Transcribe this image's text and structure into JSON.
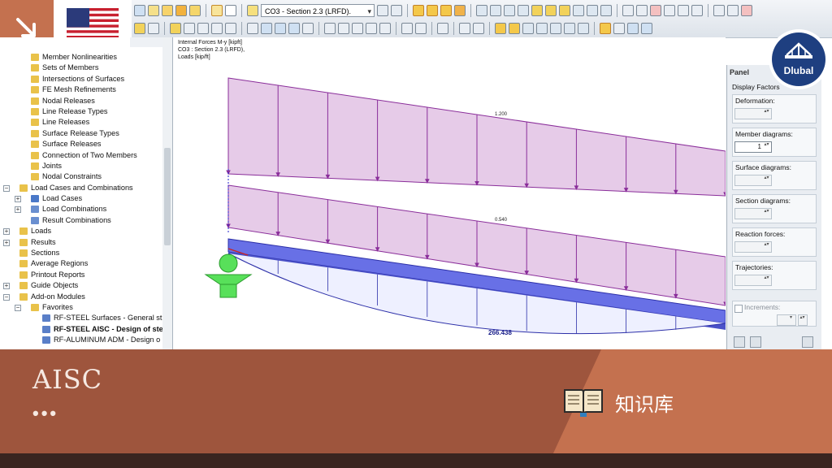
{
  "toolbar": {
    "loadcase_combo": "CO3 - Section 2.3 (LRFD).",
    "icons": [
      "undo-icon",
      "pen-icon",
      "magnifier-icon",
      "results-icon",
      "grid-icon",
      "table-icon",
      "arrow-left-icon",
      "arrow-right-icon",
      "display-icon",
      "view-icon",
      "select-icon",
      "render-icon",
      "settings-icon"
    ]
  },
  "navigator": {
    "pin_glyph": "ᐅ",
    "close_glyph": "×",
    "items": [
      {
        "label": "Member Nonlinearities",
        "level": 2,
        "icon": "folder"
      },
      {
        "label": "Sets of Members",
        "level": 2,
        "icon": "folder"
      },
      {
        "label": "Intersections of Surfaces",
        "level": 2,
        "icon": "folder"
      },
      {
        "label": "FE Mesh Refinements",
        "level": 2,
        "icon": "folder"
      },
      {
        "label": "Nodal Releases",
        "level": 2,
        "icon": "folder"
      },
      {
        "label": "Line Release Types",
        "level": 2,
        "icon": "folder"
      },
      {
        "label": "Line Releases",
        "level": 2,
        "icon": "folder"
      },
      {
        "label": "Surface Release Types",
        "level": 2,
        "icon": "folder"
      },
      {
        "label": "Surface Releases",
        "level": 2,
        "icon": "folder"
      },
      {
        "label": "Connection of Two Members",
        "level": 2,
        "icon": "folder"
      },
      {
        "label": "Joints",
        "level": 2,
        "icon": "folder"
      },
      {
        "label": "Nodal Constraints",
        "level": 2,
        "icon": "folder"
      },
      {
        "label": "Load Cases and Combinations",
        "level": 1,
        "icon": "folder",
        "exp": "−"
      },
      {
        "label": "Load Cases",
        "level": 2,
        "icon": "loadcase",
        "exp": "+"
      },
      {
        "label": "Load Combinations",
        "level": 2,
        "icon": "combo",
        "exp": "+"
      },
      {
        "label": "Result Combinations",
        "level": 2,
        "icon": "combo",
        "exp": ""
      },
      {
        "label": "Loads",
        "level": 1,
        "icon": "folder",
        "exp": "+"
      },
      {
        "label": "Results",
        "level": 1,
        "icon": "folder",
        "exp": "+"
      },
      {
        "label": "Sections",
        "level": 1,
        "icon": "folder",
        "exp": ""
      },
      {
        "label": "Average Regions",
        "level": 1,
        "icon": "folder",
        "exp": ""
      },
      {
        "label": "Printout Reports",
        "level": 1,
        "icon": "folder",
        "exp": ""
      },
      {
        "label": "Guide Objects",
        "level": 1,
        "icon": "folder",
        "exp": "+"
      },
      {
        "label": "Add-on Modules",
        "level": 1,
        "icon": "folder",
        "exp": "−"
      },
      {
        "label": "Favorites",
        "level": 2,
        "icon": "folder",
        "exp": "−"
      },
      {
        "label": "RF-STEEL Surfaces - General stre",
        "level": 3,
        "icon": "module"
      },
      {
        "label": "RF-STEEL AISC - Design of ste",
        "level": 3,
        "icon": "module",
        "bold": true
      },
      {
        "label": "RF-ALUMINUM ADM - Design o",
        "level": 3,
        "icon": "module"
      }
    ]
  },
  "graphics": {
    "info_lines": [
      "Internal Forces M-y [kipft]",
      "CO3 : Section 2.3 (LRFD),",
      "Loads [kip/ft]"
    ],
    "load_label_top": "1.200",
    "load_label_bottom": "0.540",
    "moment_label": "266.438"
  },
  "panel": {
    "title": "Panel",
    "subtitle": "Display Factors",
    "groups": [
      {
        "label": "Deformation:",
        "value": ""
      },
      {
        "label": "Member diagrams:",
        "value": "1"
      },
      {
        "label": "Surface diagrams:",
        "value": ""
      },
      {
        "label": "Section diagrams:",
        "value": ""
      },
      {
        "label": "Reaction forces:",
        "value": ""
      },
      {
        "label": "Trajectories:",
        "value": ""
      }
    ],
    "increments_label": "Increments:"
  },
  "badge": {
    "brand": "Dlubal",
    "color": "#1e3f80"
  },
  "banner": {
    "title": "AISC",
    "more": "•••",
    "kb_label": "知识库",
    "colors": {
      "dark": "#9e553d",
      "light": "#c4714f",
      "footer": "#3a2520"
    }
  }
}
